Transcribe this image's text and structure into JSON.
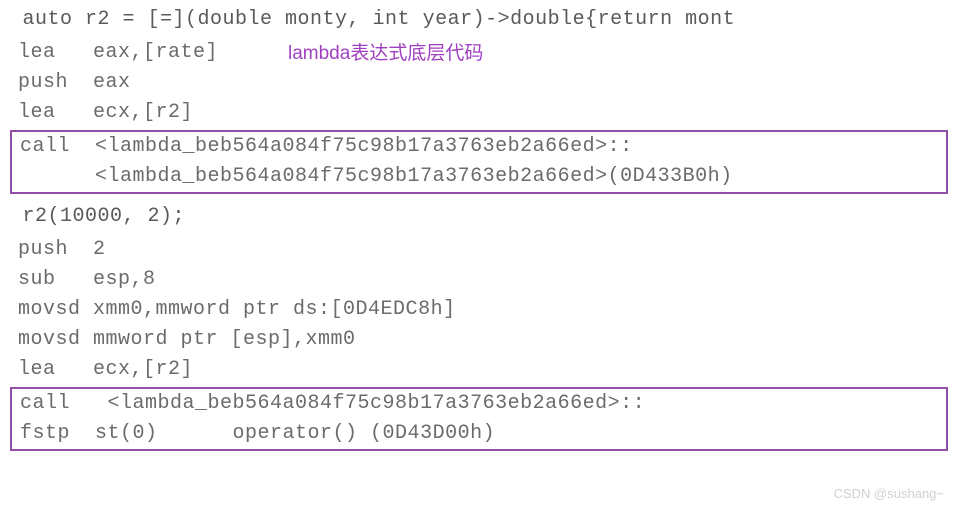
{
  "annotation": "lambda表达式底层代码",
  "cpp_line1": " auto r2 = [=](double monty, int year)->double{return mont",
  "asm1_l1": "lea   eax,[rate]",
  "asm1_l2": "push  eax",
  "asm1_l3": "lea   ecx,[r2]",
  "box1_l1": "call  <lambda_beb564a084f75c98b17a3763eb2a66ed>::",
  "box1_l2": "      <lambda_beb564a084f75c98b17a3763eb2a66ed>(0D433B0h)",
  "cpp_line2": " r2(10000, 2);",
  "asm2_l1": "push  2",
  "asm2_l2": "sub   esp,8",
  "asm2_l3": "movsd xmm0,mmword ptr ds:[0D4EDC8h]",
  "asm2_l4": "movsd mmword ptr [esp],xmm0",
  "asm2_l5": "lea   ecx,[r2]",
  "box2_l1": "call   <lambda_beb564a084f75c98b17a3763eb2a66ed>::",
  "box2_l2": "fstp  st(0)      operator() (0D43D00h)",
  "watermark": "CSDN @sushang~"
}
